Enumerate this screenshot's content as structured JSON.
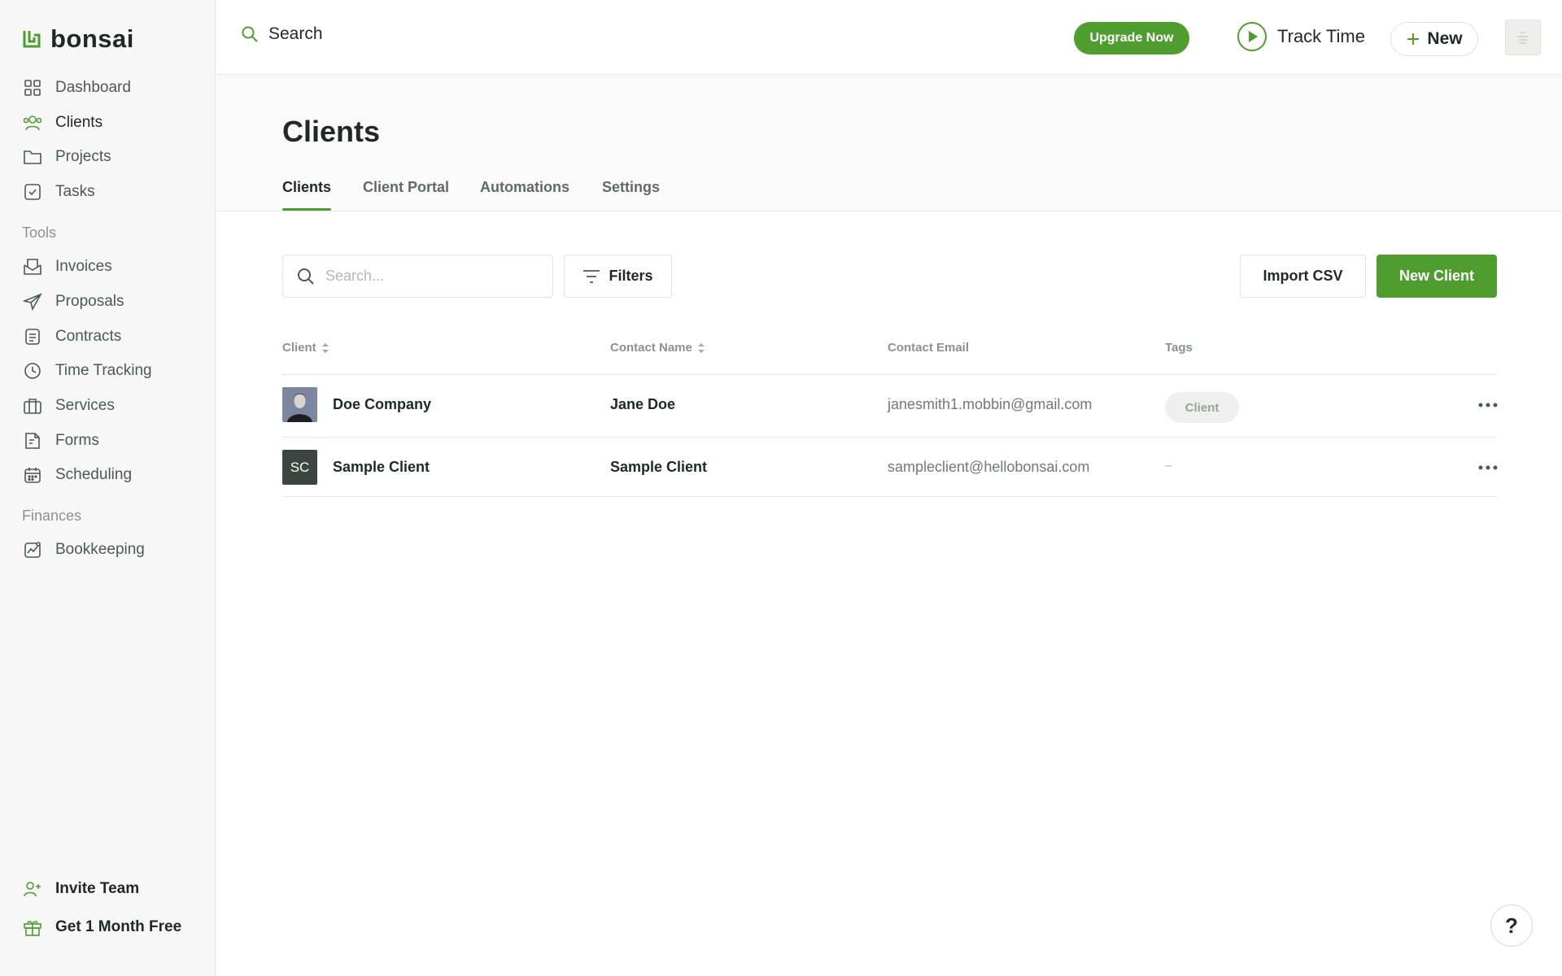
{
  "brand": {
    "name": "bonsai",
    "accent": "#4f9d2e"
  },
  "sidebar": {
    "main_items": [
      {
        "label": "Dashboard",
        "icon": "grid-icon"
      },
      {
        "label": "Clients",
        "icon": "users-icon",
        "active": true
      },
      {
        "label": "Projects",
        "icon": "folder-icon"
      },
      {
        "label": "Tasks",
        "icon": "checkbox-icon"
      }
    ],
    "tools_label": "Tools",
    "tools_items": [
      {
        "label": "Invoices",
        "icon": "invoice-icon"
      },
      {
        "label": "Proposals",
        "icon": "send-icon"
      },
      {
        "label": "Contracts",
        "icon": "document-icon"
      },
      {
        "label": "Time Tracking",
        "icon": "clock-icon"
      },
      {
        "label": "Services",
        "icon": "briefcase-icon"
      },
      {
        "label": "Forms",
        "icon": "form-icon"
      },
      {
        "label": "Scheduling",
        "icon": "calendar-icon"
      }
    ],
    "finances_label": "Finances",
    "finances_items": [
      {
        "label": "Bookkeeping",
        "icon": "chart-icon"
      }
    ],
    "bottom_items": [
      {
        "label": "Invite Team",
        "icon": "user-plus-icon"
      },
      {
        "label": "Get 1 Month Free",
        "icon": "gift-icon"
      }
    ]
  },
  "topbar": {
    "search_label": "Search",
    "upgrade_label": "Upgrade Now",
    "track_time_label": "Track Time",
    "new_label": "New"
  },
  "page": {
    "title": "Clients",
    "tabs": [
      "Clients",
      "Client Portal",
      "Automations",
      "Settings"
    ],
    "active_tab": "Clients"
  },
  "toolbar": {
    "search_placeholder": "Search...",
    "filters_label": "Filters",
    "import_label": "Import CSV",
    "new_client_label": "New Client"
  },
  "table": {
    "columns": [
      "Client",
      "Contact Name",
      "Contact Email",
      "Tags"
    ],
    "rows": [
      {
        "client": "Doe Company",
        "contact_name": "Jane Doe",
        "email": "janesmith1.mobbin@gmail.com",
        "tag": "Client",
        "avatar": "photo"
      },
      {
        "client": "Sample Client",
        "contact_name": "Sample Client",
        "email": "sampleclient@hellobonsai.com",
        "tag": "–",
        "avatar_initials": "SC"
      }
    ]
  },
  "help_label": "?"
}
